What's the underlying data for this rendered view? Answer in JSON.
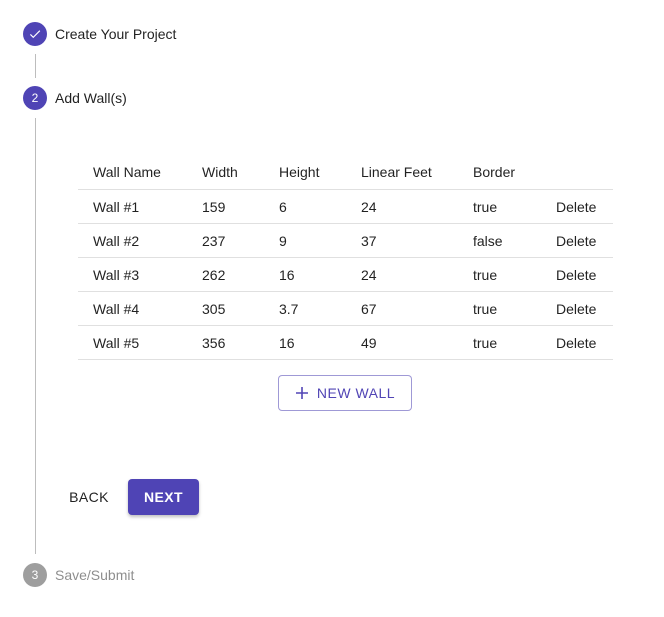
{
  "colors": {
    "primary": "#4f44b5",
    "inactive_step": "#9e9e9e",
    "connector": "#bdbdbd"
  },
  "stepper": {
    "steps": [
      {
        "label": "Create Your Project",
        "state": "completed",
        "icon": "check-icon"
      },
      {
        "number": "2",
        "label": "Add Wall(s)",
        "state": "active"
      },
      {
        "number": "3",
        "label": "Save/Submit",
        "state": "inactive"
      }
    ]
  },
  "table": {
    "headers": [
      "Wall Name",
      "Width",
      "Height",
      "Linear Feet",
      "Border",
      ""
    ],
    "rows": [
      {
        "name": "Wall #1",
        "width": "159",
        "height": "6",
        "linear_feet": "24",
        "border": "true",
        "action": "Delete"
      },
      {
        "name": "Wall #2",
        "width": "237",
        "height": "9",
        "linear_feet": "37",
        "border": "false",
        "action": "Delete"
      },
      {
        "name": "Wall #3",
        "width": "262",
        "height": "16",
        "linear_feet": "24",
        "border": "true",
        "action": "Delete"
      },
      {
        "name": "Wall #4",
        "width": "305",
        "height": "3.7",
        "linear_feet": "67",
        "border": "true",
        "action": "Delete"
      },
      {
        "name": "Wall #5",
        "width": "356",
        "height": "16",
        "linear_feet": "49",
        "border": "true",
        "action": "Delete"
      }
    ]
  },
  "actions": {
    "new_wall_label": "NEW WALL",
    "new_wall_icon": "plus-icon",
    "back_label": "BACK",
    "next_label": "NEXT"
  }
}
